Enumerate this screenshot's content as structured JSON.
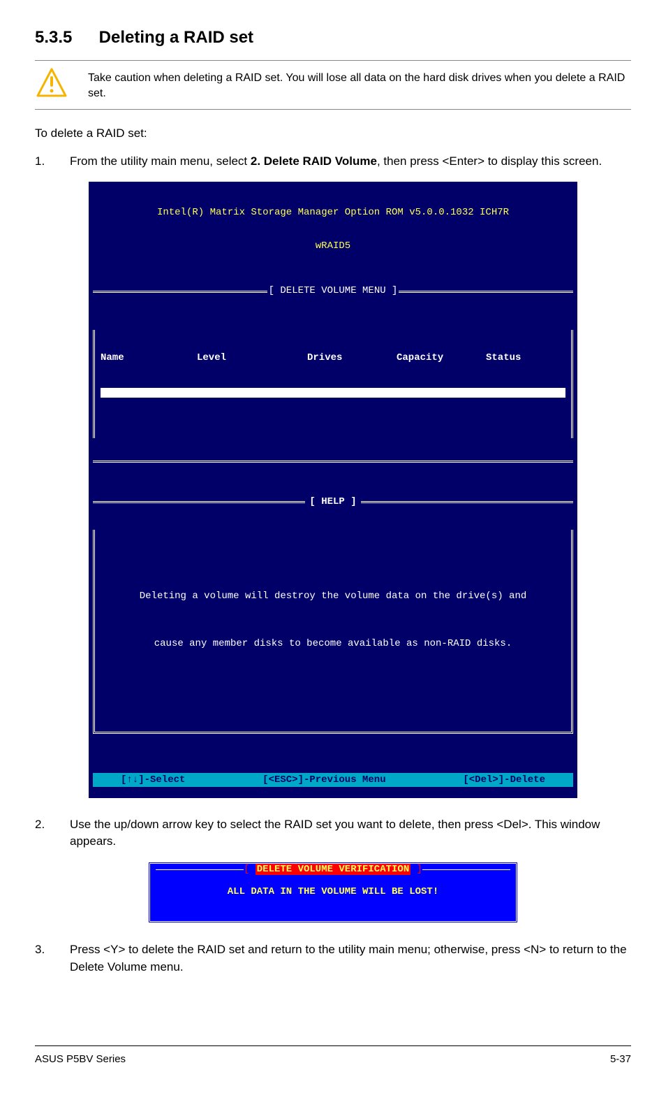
{
  "heading": {
    "number": "5.3.5",
    "title": "Deleting a RAID set"
  },
  "warning": "Take caution when deleting a RAID set. You will lose all data on the hard disk drives when you delete a RAID set.",
  "intro": "To delete a RAID set:",
  "steps": {
    "s1_pre": "From the utility main menu, select ",
    "s1_bold": "2. Delete RAID Volume",
    "s1_post": ", then press <Enter> to display this screen.",
    "s2": "Use the up/down arrow key to select the RAID set you want to delete, then press <Del>. This window appears.",
    "s3": "Press <Y> to delete the RAID set and return to the utility main menu; otherwise, press <N> to return to the Delete Volume menu."
  },
  "term": {
    "title1": "Intel(R) Matrix Storage Manager Option ROM v5.0.0.1032 ICH7R",
    "title2": "wRAID5",
    "delete_menu": "DELETE VOLUME MENU",
    "cols": {
      "name": "Name",
      "level": "Level",
      "drives": "Drives",
      "capacity": "Capacity",
      "status": "Status"
    },
    "help_label": "HELP",
    "help_line1": "Deleting a volume will destroy the volume data on the drive(s) and",
    "help_line2": "cause any member disks to become available as non-RAID disks.",
    "footer_select": "[↑↓]-Select",
    "footer_prev": "[<ESC>]-Previous Menu",
    "footer_del": "[<Del>]-Delete"
  },
  "dialog": {
    "title": "DELETE VOLUME VERIFICATION",
    "line": "ALL DATA IN THE VOLUME WILL BE LOST!"
  },
  "footer": {
    "left": "ASUS P5BV Series",
    "right": "5-37"
  }
}
